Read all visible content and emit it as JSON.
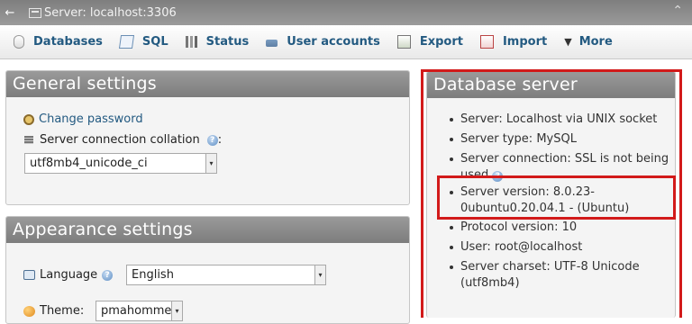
{
  "titlebar": {
    "title": "Server: localhost:3306",
    "back_glyph": "←",
    "collapse_glyph": "⌃"
  },
  "tabs": [
    {
      "label": "Databases",
      "icon": "database-icon"
    },
    {
      "label": "SQL",
      "icon": "sql-icon"
    },
    {
      "label": "Status",
      "icon": "status-icon"
    },
    {
      "label": "User accounts",
      "icon": "user-accounts-icon"
    },
    {
      "label": "Export",
      "icon": "export-icon"
    },
    {
      "label": "Import",
      "icon": "import-icon"
    },
    {
      "label": "More",
      "icon": "caret-down-icon"
    }
  ],
  "general_settings": {
    "title": "General settings",
    "change_password": "Change password",
    "collation_label": "Server connection collation",
    "collation_colon": ":",
    "collation_value": "utf8mb4_unicode_ci"
  },
  "appearance_settings": {
    "title": "Appearance settings",
    "language_label": "Language",
    "language_value": "English",
    "theme_label": "Theme:",
    "theme_value": "pmahomme"
  },
  "database_server": {
    "title": "Database server",
    "items": [
      "Server: Localhost via UNIX socket",
      "Server type: MySQL",
      "Server connection: SSL is not being used",
      "Server version: 8.0.23-0ubuntu0.20.04.1 - (Ubuntu)",
      "Protocol version: 10",
      "User: root@localhost",
      "Server charset: UTF-8 Unicode (utf8mb4)"
    ]
  },
  "colors": {
    "link": "#235a81",
    "panel_header": "#8b8b8b",
    "highlight_border": "#d21a1a"
  }
}
